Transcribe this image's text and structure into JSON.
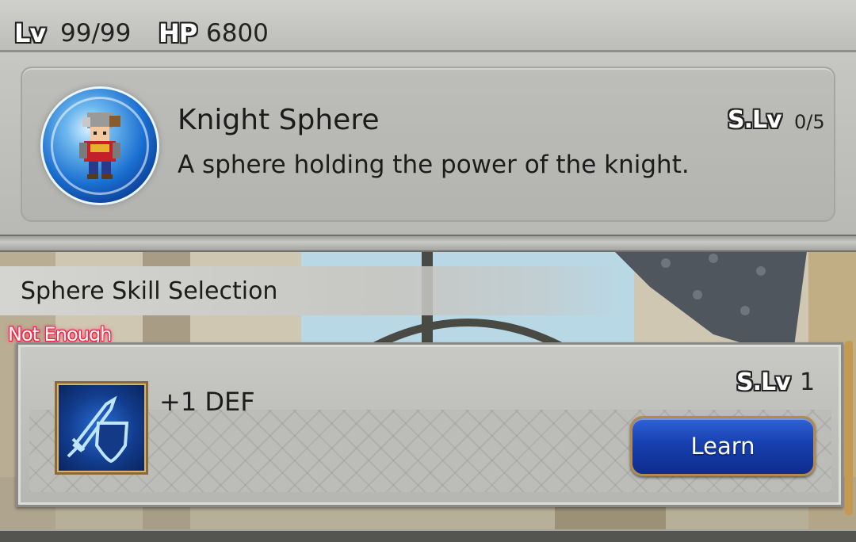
{
  "stats": {
    "level_label": "Lv",
    "level_value": "99/99",
    "hp_label": "HP",
    "hp_value": "6800"
  },
  "sphere": {
    "icon": "knight-sprite-orb-icon",
    "name": "Knight Sphere",
    "description": "A sphere holding the power of the knight.",
    "slv_label": "S.Lv",
    "slv_value": "0/5"
  },
  "section": {
    "title": "Sphere Skill Selection"
  },
  "skill": {
    "status": "Not Enough",
    "icon": "sword-shield-icon",
    "name": "+1 DEF",
    "slv_label": "S.Lv",
    "slv_value": "1",
    "learn_label": "Learn"
  },
  "colors": {
    "panel": "#b8b8b4",
    "button": "#1740b0",
    "warning": "#ff2a4a"
  }
}
